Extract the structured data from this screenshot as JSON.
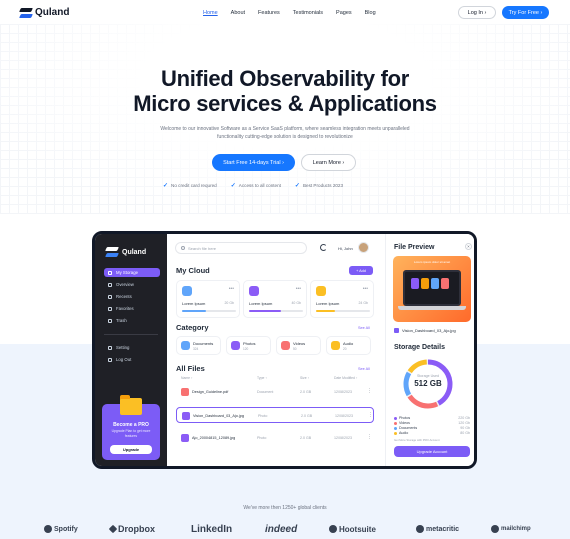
{
  "brand": {
    "name": "Quland"
  },
  "nav": {
    "links": [
      "Home",
      "About",
      "Features",
      "Testimonials",
      "Pages",
      "Blog"
    ],
    "active": "Home",
    "login_label": "Log In ›",
    "try_label": "Try For Free ›"
  },
  "hero": {
    "title_line1": "Unified Observability for",
    "title_line2": "Micro services & Applications",
    "subtitle": "Welcome to our innovative Software as a Service SaaS platform, where seamless integration meets unparalleled functionality cutting-edge solution is designed to revolutionize",
    "cta_primary": "Start Free 14-days Trial ›",
    "cta_secondary": "Learn More ›",
    "checks": [
      "No credit card requred",
      "Access to all content",
      "Best Products 2023"
    ]
  },
  "dashboard": {
    "brand": "Quland",
    "sidebar": {
      "items": [
        "My Storage",
        "Overview",
        "Recents",
        "Favorites",
        "Trash"
      ],
      "bottom_items": [
        "Setting",
        "Log Out"
      ],
      "promo_title": "Become a PRO",
      "promo_desc": "Upgrade Plan to get more features",
      "promo_button": "Upgrade"
    },
    "search_placeholder": "Search file here",
    "user_name": "Hi, John",
    "my_cloud": {
      "title": "My Cloud",
      "add_label": "+ Add",
      "cards": [
        {
          "label": "Lorem Ipsum",
          "size": "20 Gb",
          "color": "#60a5fa",
          "fill": 0.45
        },
        {
          "label": "Lorem Ipsum",
          "size": "40 Gb",
          "color": "#8b5cf6",
          "fill": 0.6
        },
        {
          "label": "Lorem Ipsum",
          "size": "24 Gb",
          "color": "#fbbf24",
          "fill": 0.35
        }
      ]
    },
    "category": {
      "title": "Category",
      "see_all": "See All",
      "items": [
        {
          "name": "Documents",
          "count": "324",
          "color": "#60a5fa"
        },
        {
          "name": "Photos",
          "count": "120",
          "color": "#8b5cf6"
        },
        {
          "name": "Videos",
          "count": "50",
          "color": "#f87171"
        },
        {
          "name": "Audio",
          "count": "20",
          "color": "#fbbf24"
        }
      ]
    },
    "files": {
      "title": "All Files",
      "see_all": "See All",
      "columns": [
        "Name ↑",
        "Type ↑",
        "Size ↑",
        "Date Modified ↑"
      ],
      "rows": [
        {
          "name": "Design_Guideline.pdf",
          "type": "Document",
          "size": "2.0 GB",
          "date": "12/08/2023",
          "color": "#f87171"
        },
        {
          "name": "Vision_Dashboard_03_Ajo.jpg",
          "type": "Photo",
          "size": "2.0 GB",
          "date": "12/08/2023",
          "color": "#8b5cf6"
        },
        {
          "name": "Ajo_20004815_12089.jpg",
          "type": "Photo",
          "size": "2.0 GB",
          "date": "12/08/2023",
          "color": "#8b5cf6"
        }
      ]
    },
    "preview": {
      "title": "File Preview",
      "caption": "Lorem ipsum dolor sit amet",
      "file_name": "Vision_Dashboard_03_Ajo.jpg"
    },
    "storage": {
      "title": "Storage Details",
      "used_label": "Storage Used",
      "used_value": "512 GB",
      "legend": [
        {
          "name": "Photos",
          "value": "220 Gb",
          "color": "#8b5cf6"
        },
        {
          "name": "Videos",
          "value": "120 Gb",
          "color": "#f87171"
        },
        {
          "name": "Documents",
          "value": "90 Gb",
          "color": "#60a5fa"
        },
        {
          "name": "Audio",
          "value": "80 Gb",
          "color": "#fbbf24"
        }
      ],
      "note": "Get More Storage with PRO Account",
      "upgrade_label": "Upgrade Account"
    }
  },
  "clients": {
    "caption": "We've more then 1250+ global clients",
    "brands": [
      "Spotify",
      "Dropbox",
      "LinkedIn",
      "indeed",
      "Hootsuite",
      "metacritic",
      "mailchimp"
    ]
  }
}
